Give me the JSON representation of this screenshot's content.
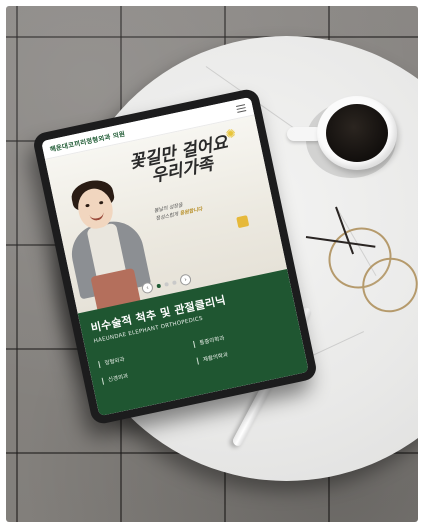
{
  "site": {
    "logo_text": "해운대코끼리정형외과 의원",
    "menu_icon": "hamburger-menu-icon"
  },
  "hero": {
    "title_line1": "꽃길만 걸어요",
    "title_line2": "우리가족",
    "subtitle_line1": "봄날의 성장을",
    "subtitle_line2": "정성스럽게",
    "subtitle_highlight": "응원합니다",
    "prev_icon": "chevron-left-icon",
    "next_icon": "chevron-right-icon",
    "slide_count": 3,
    "active_slide": 1
  },
  "section": {
    "headline": "비수술적 척추 및 관절클리닉",
    "subhead": "HAEUNDAE ELEPHANT ORTHOPEDICS",
    "links": [
      {
        "label": "정형외과"
      },
      {
        "label": "통증의학과"
      },
      {
        "label": "신경외과"
      },
      {
        "label": "재활의학과"
      }
    ]
  },
  "colors": {
    "brand_green": "#1f5631",
    "accent_yellow": "#e8c53a"
  }
}
